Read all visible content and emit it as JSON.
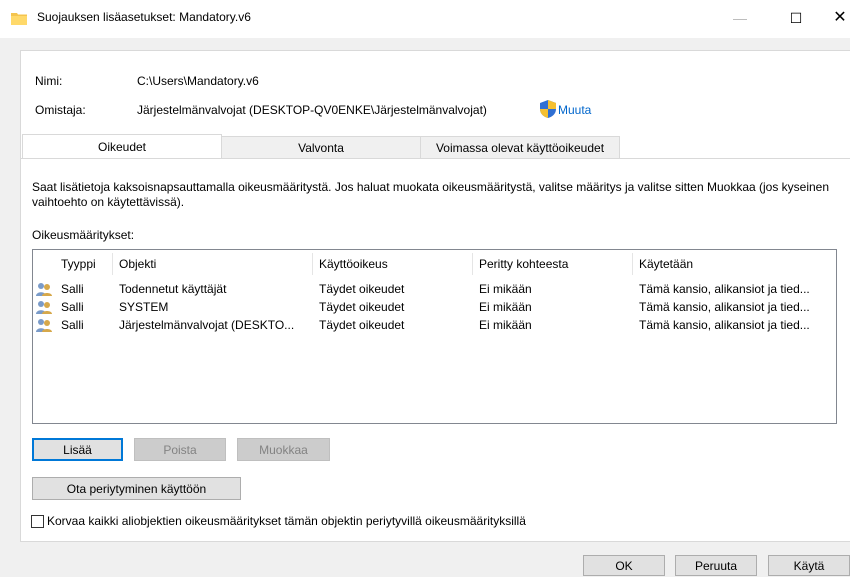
{
  "window": {
    "title": "Suojauksen lisäasetukset: Mandatory.v6",
    "minimize": "—",
    "maximize": "☐",
    "close": "✕"
  },
  "info": {
    "name_label": "Nimi:",
    "name_value": "C:\\Users\\Mandatory.v6",
    "owner_label": "Omistaja:",
    "owner_value": "Järjestelmänvalvojat (DESKTOP-QV0ENKE\\Järjestelmänvalvojat)",
    "change_link": "Muuta"
  },
  "tabs": [
    {
      "label": "Oikeudet",
      "active": true
    },
    {
      "label": "Valvonta",
      "active": false
    },
    {
      "label": "Voimassa olevat käyttöoikeudet",
      "active": false
    }
  ],
  "description": "Saat lisätietoja kaksoisnapsauttamalla oikeusmääritystä. Jos haluat muokata oikeusmääritystä, valitse määritys ja valitse sitten Muokkaa (jos kyseinen vaihtoehto on käytettävissä).",
  "entries_label": "Oikeusmääritykset:",
  "table": {
    "headers": [
      "Tyyppi",
      "Objekti",
      "Käyttöoikeus",
      "Peritty kohteesta",
      "Käytetään"
    ],
    "rows": [
      [
        "Salli",
        "Todennetut käyttäjät",
        "Täydet oikeudet",
        "Ei mikään",
        "Tämä kansio, alikansiot ja tied..."
      ],
      [
        "Salli",
        "SYSTEM",
        "Täydet oikeudet",
        "Ei mikään",
        "Tämä kansio, alikansiot ja tied..."
      ],
      [
        "Salli",
        "Järjestelmänvalvojat (DESKTO...",
        "Täydet oikeudet",
        "Ei mikään",
        "Tämä kansio, alikansiot ja tied..."
      ]
    ]
  },
  "buttons": {
    "add": "Lisää",
    "remove": "Poista",
    "edit": "Muokkaa",
    "enable_inheritance": "Ota periytyminen käyttöön",
    "ok": "OK",
    "cancel": "Peruuta",
    "apply": "Käytä"
  },
  "replace_checkbox": {
    "label": "Korvaa kaikki aliobjektien oikeusmääritykset tämän objektin periytyvillä oikeusmäärityksillä",
    "checked": false
  },
  "colors": {
    "accent": "#0078d7",
    "link": "#0066cc"
  }
}
